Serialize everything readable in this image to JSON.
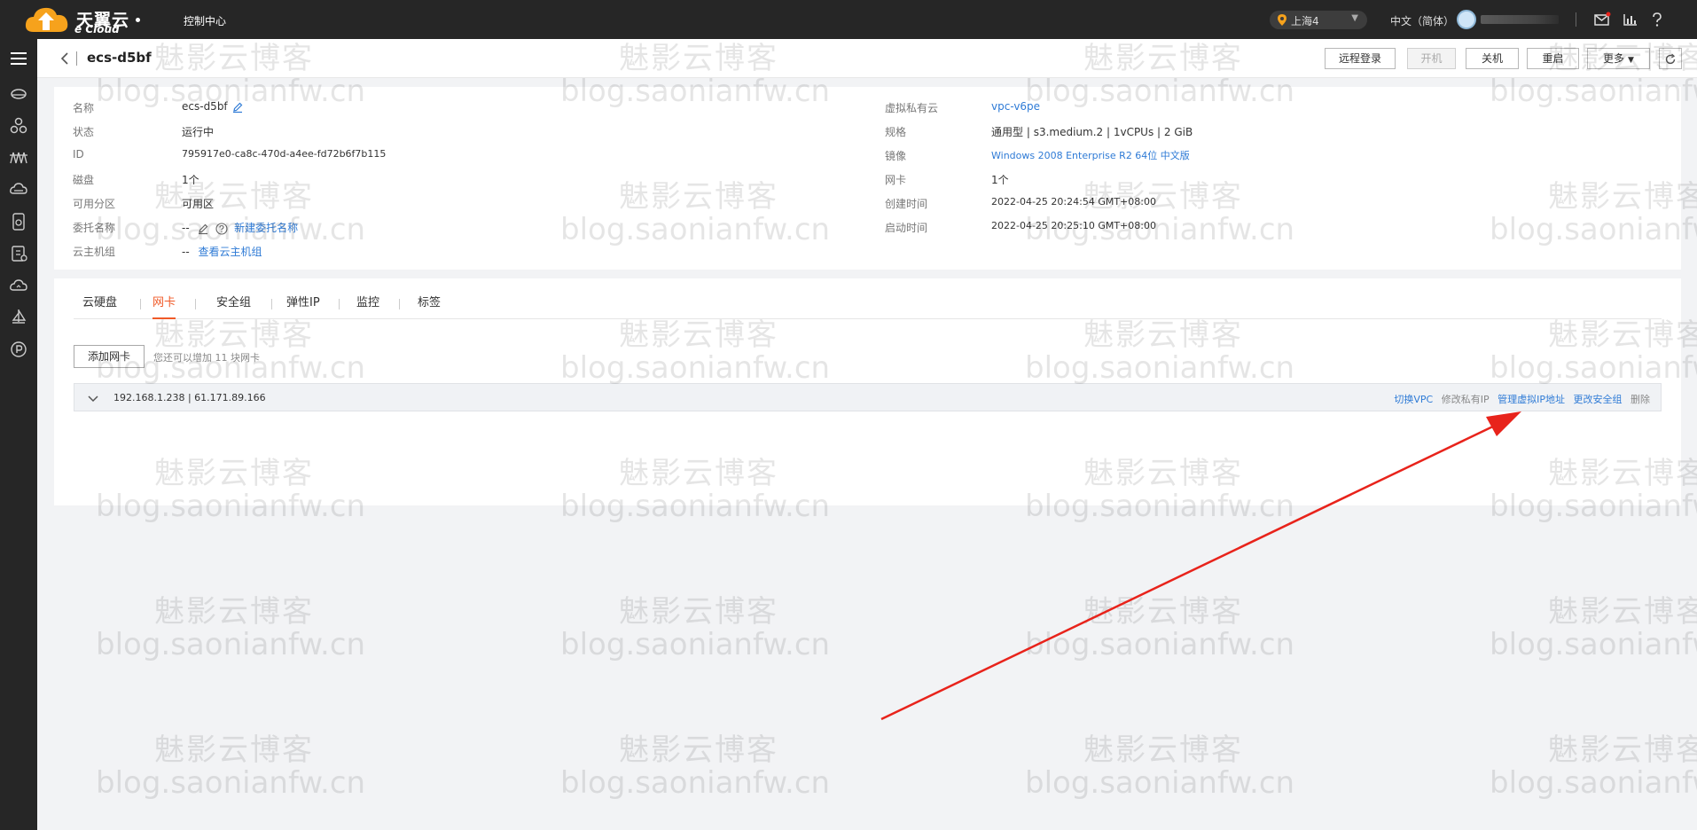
{
  "topbar": {
    "brand_cn": "天翼云",
    "brand_en": "e Cloud",
    "console": "控制中心",
    "region": "上海4",
    "language": "中文（简体）"
  },
  "header": {
    "title": "ecs-d5bf",
    "buttons": {
      "remote_login": "远程登录",
      "power_on": "开机",
      "shutdown": "关机",
      "restart": "重启",
      "more": "更多"
    }
  },
  "info": {
    "left": [
      {
        "label": "名称",
        "value": "ecs-d5bf"
      },
      {
        "label": "状态",
        "value": "运行中"
      },
      {
        "label": "ID",
        "value": "795917e0-ca8c-470d-a4ee-fd72b6f7b115"
      },
      {
        "label": "磁盘",
        "value": "1个"
      },
      {
        "label": "可用分区",
        "value": "可用区"
      },
      {
        "label": "委托名称",
        "value": "--",
        "link": "新建委托名称"
      },
      {
        "label": "云主机组",
        "value": "--",
        "link": "查看云主机组"
      }
    ],
    "right": [
      {
        "label": "虚拟私有云",
        "value": "vpc-v6pe"
      },
      {
        "label": "规格",
        "value_strong": "通用型",
        "value": " | s3.medium.2 | 1vCPUs | 2 GiB"
      },
      {
        "label": "镜像",
        "value": "Windows 2008 Enterprise R2 64位 中文版"
      },
      {
        "label": "网卡",
        "value": "1个"
      },
      {
        "label": "创建时间",
        "value": "2022-04-25 20:24:54 GMT+08:00"
      },
      {
        "label": "启动时间",
        "value": "2022-04-25 20:25:10 GMT+08:00"
      }
    ]
  },
  "tabs": [
    "云硬盘",
    "网卡",
    "安全组",
    "弹性IP",
    "监控",
    "标签"
  ],
  "nic": {
    "add_button": "添加网卡",
    "tip": "您还可以增加 11 块网卡",
    "address": "192.168.1.238 | 61.171.89.166",
    "actions": {
      "switch_vpc": "切换VPC",
      "modify_ip": "修改私有IP",
      "manage_vip": "管理虚拟IP地址",
      "change_sg": "更改安全组",
      "delete": "删除"
    }
  },
  "watermark": {
    "cn": "魅影云博客",
    "en": "blog.saonianfw.cn"
  },
  "colors": {
    "topbar": "#262626",
    "accent_tab": "#f05a28",
    "link": "#2f7bd6",
    "annotation_arrow": "#e8231b"
  }
}
